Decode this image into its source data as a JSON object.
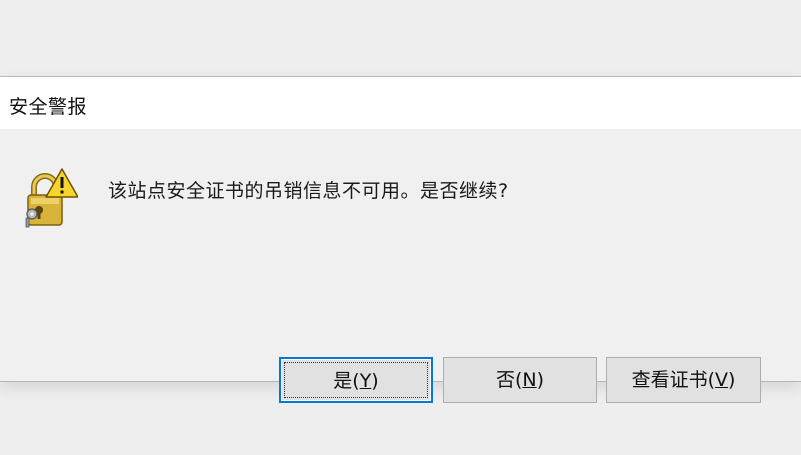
{
  "dialog": {
    "title": "安全警报",
    "message": "该站点安全证书的吊销信息不可用。是否继续?",
    "icon": "security-warning-lock-icon"
  },
  "buttons": {
    "yes": {
      "prefix": "是(",
      "accel": "Y",
      "suffix": ")"
    },
    "no": {
      "prefix": "否(",
      "accel": "N",
      "suffix": ")"
    },
    "view_cert": {
      "prefix": "查看证书(",
      "accel": "V",
      "suffix": ")"
    }
  },
  "colors": {
    "focus_border": "#0078d7",
    "warning_yellow": "#f6d42c",
    "lock_gold": "#d9b43a"
  }
}
